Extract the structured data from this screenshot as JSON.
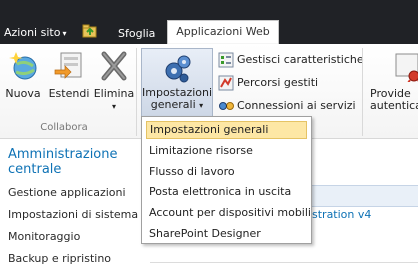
{
  "topbar": {
    "site_actions": "Azioni sito",
    "site_actions_arrow": "▾",
    "tabs": [
      {
        "label": "Sfoglia"
      },
      {
        "label": "Applicazioni Web"
      }
    ]
  },
  "ribbon": {
    "buttons": [
      {
        "label": "Nuova",
        "icon": "new-web-app-icon"
      },
      {
        "label": "Estendi",
        "icon": "extend-icon"
      },
      {
        "label": "Elimina",
        "icon": "delete-icon"
      }
    ],
    "elimina_arrow": "▾",
    "group_label": "Collabora",
    "impostazioni": {
      "label_line1": "Impostazioni",
      "label_line2": "generali",
      "arrow": "▾",
      "icon": "gears-icon"
    },
    "small_items": [
      {
        "label": "Gestisci caratteristiche",
        "icon": "features-icon"
      },
      {
        "label": "Percorsi gestiti",
        "icon": "paths-icon"
      },
      {
        "label": "Connessioni ai servizi",
        "icon": "connections-icon"
      }
    ],
    "provide": {
      "line1": "Provide",
      "line2": "autenticaz"
    }
  },
  "leftnav": {
    "title_line1": "Amministrazione",
    "title_line2": "centrale",
    "links": [
      "Gestione applicazioni",
      "Impostazioni di sistema",
      "Monitoraggio",
      "Backup e ripristino"
    ]
  },
  "main": {
    "partial_text": "stration v4"
  },
  "dropdown": {
    "items": [
      "Impostazioni generali",
      "Limitazione risorse",
      "Flusso di lavoro",
      "Posta elettronica in uscita",
      "Account per dispositivi mobili",
      "SharePoint Designer"
    ],
    "selected_index": 0
  },
  "colors": {
    "topbar": "#202226",
    "link_blue": "#0e72b5",
    "highlight": "#fde7a5"
  }
}
